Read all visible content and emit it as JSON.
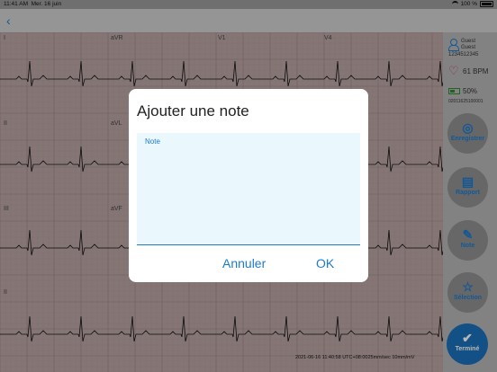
{
  "status": {
    "time": "11:41 AM",
    "date": "Mer. 16 juin",
    "battery": "100 %"
  },
  "leads": [
    "I",
    "aVR",
    "V1",
    "V4",
    "II",
    "aVL",
    "III",
    "aVF",
    "II"
  ],
  "footer": "2021-06-16 11:40:58 UTC+08:0025mm/sec 10mm/mV",
  "patient": {
    "name1": "Guest",
    "name2": "Guest",
    "id": "1234512345"
  },
  "heart_rate": "61 BPM",
  "battery_level": "50%",
  "device_id": "02011625100001",
  "buttons": {
    "record": "Enregistrer",
    "report": "Rapport",
    "note": "Note",
    "select": "Sélection",
    "done": "Terminé"
  },
  "dialog": {
    "title": "Ajouter une note",
    "placeholder": "Note",
    "cancel": "Annuler",
    "ok": "OK"
  },
  "colors": {
    "accent": "#1b7bcf",
    "done_button": "#1b6fb9"
  }
}
